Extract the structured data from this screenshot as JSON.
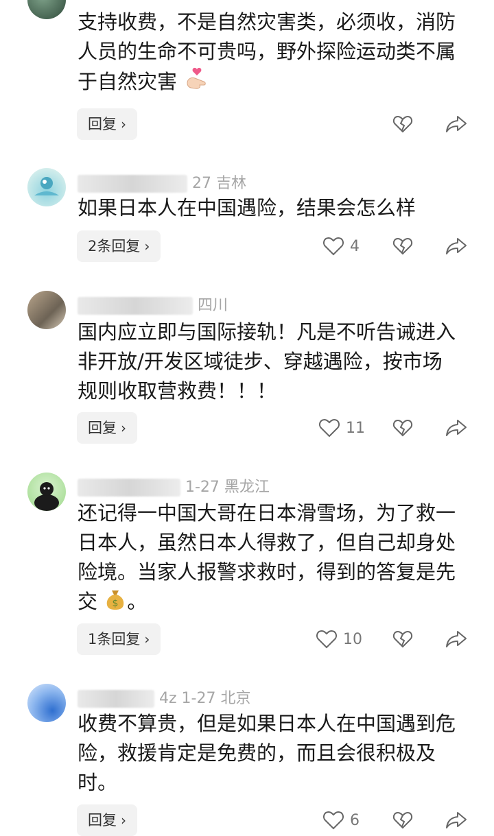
{
  "comments": [
    {
      "meta": "",
      "text": "支持收费，不是自然灾害类，必须收，消防人员的生命不可贵吗，野外探险运动类不属于自然灾害",
      "reply_label": "回复",
      "likes": ""
    },
    {
      "meta": "27  吉林",
      "text": "如果日本人在中国遇险，结果会怎么样",
      "reply_label": "2条回复",
      "likes": "4"
    },
    {
      "meta": "四川",
      "text": "国内应立即与国际接轨！凡是不听告诫进入非开放/开发区域徒步、穿越遇险，按市场规则收取营救费！！！",
      "reply_label": "回复",
      "likes": "11"
    },
    {
      "meta": "1-27  黑龙江",
      "text": "还记得一中国大哥在日本滑雪场，为了救一日本人，虽然日本人得救了，但自己却身处险境。当家人报警求救时，得到的答复是先交",
      "text_tail": "。",
      "reply_label": "1条回复",
      "likes": "10"
    },
    {
      "meta": "4z  1-27  北京",
      "text": "收费不算贵，但是如果日本人在中国遇到危险，救援肯定是免费的，而且会很积极及时。",
      "reply_label": "回复",
      "likes": "6"
    }
  ],
  "icons": {
    "like": "heart-outline-icon",
    "dislike": "broken-heart-icon",
    "share": "share-arrow-icon",
    "chevron": "chevron-right-icon"
  }
}
